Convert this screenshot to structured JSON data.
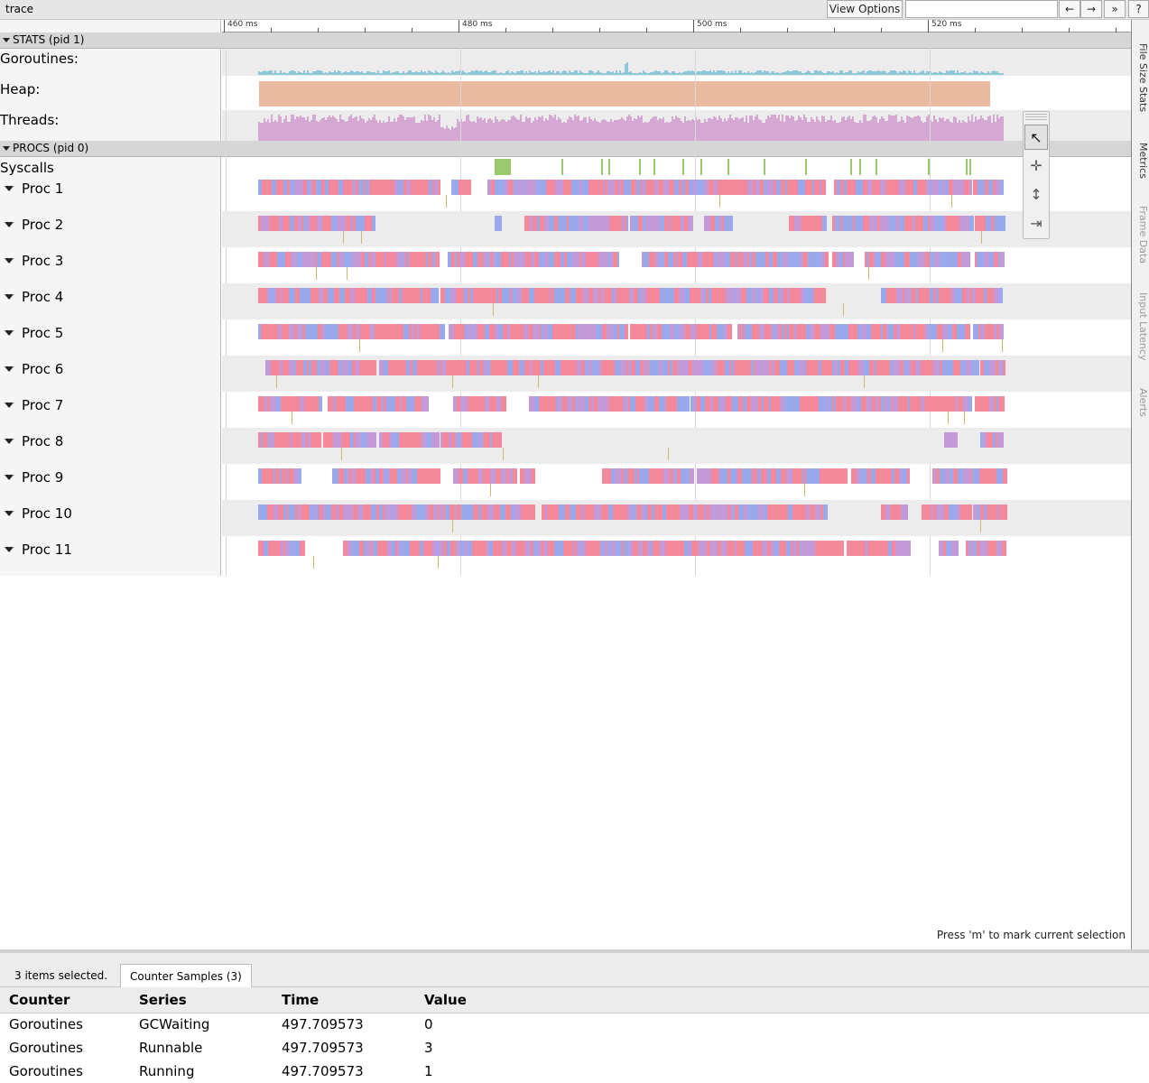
{
  "title": "trace",
  "toolbar": {
    "view_options_label": "View Options",
    "search_value": "",
    "back_label": "←",
    "forward_label": "→",
    "more_label": "»",
    "help_label": "?"
  },
  "ruler": {
    "ticks": [
      "460 ms",
      "480 ms",
      "500 ms",
      "520 ms"
    ]
  },
  "stats_group": {
    "label": "STATS (pid 1)",
    "rows": [
      {
        "label": "Goroutines:",
        "color": "#8cc8d8"
      },
      {
        "label": "Heap:",
        "color": "#e9b9a0"
      },
      {
        "label": "Threads:",
        "color": "#d5a8d4"
      }
    ]
  },
  "procs_group": {
    "label": "PROCS (pid 0)",
    "syscalls_label": "Syscalls",
    "procs": [
      "Proc 1",
      "Proc 2",
      "Proc 3",
      "Proc 4",
      "Proc 5",
      "Proc 6",
      "Proc 7",
      "Proc 8",
      "Proc 9",
      "Proc 10",
      "Proc 11"
    ]
  },
  "colors": {
    "slice_pink": "#f4899c",
    "slice_blue": "#9aa8ec",
    "slice_violet": "#c39ad8",
    "syscall_green": "#9ac86c",
    "flow_olive": "#c8b870"
  },
  "mode_selector": {
    "select_icon": "↖",
    "pan_icon": "✛",
    "zoom_icon": "↕",
    "timing_icon": "⇥"
  },
  "side_tabs": [
    {
      "label": "File Size Stats",
      "active": true
    },
    {
      "label": "Metrics",
      "active": true
    },
    {
      "label": "Frame Data",
      "active": false
    },
    {
      "label": "Input Latency",
      "active": false
    },
    {
      "label": "Alerts",
      "active": false
    }
  ],
  "hint": "Press 'm' to mark current selection",
  "bottom": {
    "selected_count": "3 items selected.",
    "tab_label": "Counter Samples (3)",
    "columns": [
      "Counter",
      "Series",
      "Time",
      "Value"
    ],
    "rows": [
      [
        "Goroutines",
        "GCWaiting",
        "497.709573",
        "0"
      ],
      [
        "Goroutines",
        "Runnable",
        "497.709573",
        "3"
      ],
      [
        "Goroutines",
        "Running",
        "497.709573",
        "1"
      ]
    ]
  }
}
